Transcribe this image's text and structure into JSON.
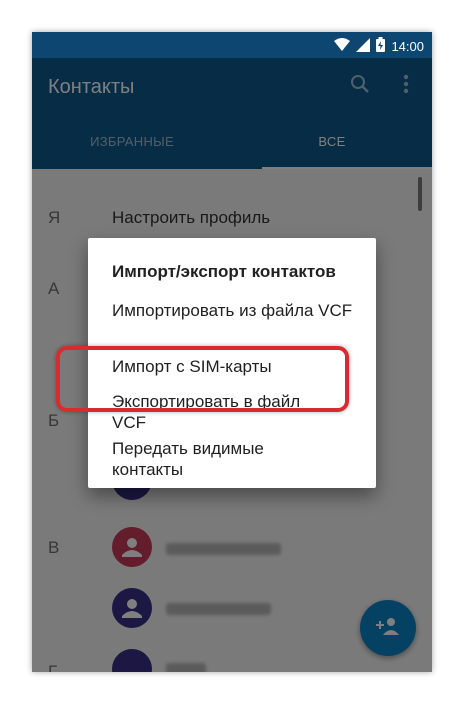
{
  "status": {
    "time": "14:00",
    "wifi_icon": "wifi-icon",
    "signal_icon": "signal-icon",
    "battery_icon": "battery-charging-icon"
  },
  "appbar": {
    "title": "Контакты",
    "search_icon": "search-icon",
    "more_icon": "more-vert-icon",
    "color": "#0e5a8c"
  },
  "tabs": [
    {
      "label": "ИЗБРАННЫЕ",
      "selected": false
    },
    {
      "label": "ВСЕ",
      "selected": true
    }
  ],
  "list": {
    "letters": [
      "Я",
      "А",
      "Б",
      "В",
      "Г"
    ],
    "profile": "Настроить профиль"
  },
  "dialog": {
    "title": "Импорт/экспорт контактов",
    "items": [
      "Импортировать из файла VCF",
      "Импорт с SIM-карты",
      "Экспортировать в файл VCF",
      "Передать видимые контакты"
    ],
    "highlighted_index": 2
  },
  "fab": {
    "icon": "add-person-icon",
    "color": "#0a83c6"
  },
  "colors": {
    "highlight": "#d92a2f",
    "avatar_red": "#c83a5a",
    "avatar_purple": "#3b2f86"
  }
}
